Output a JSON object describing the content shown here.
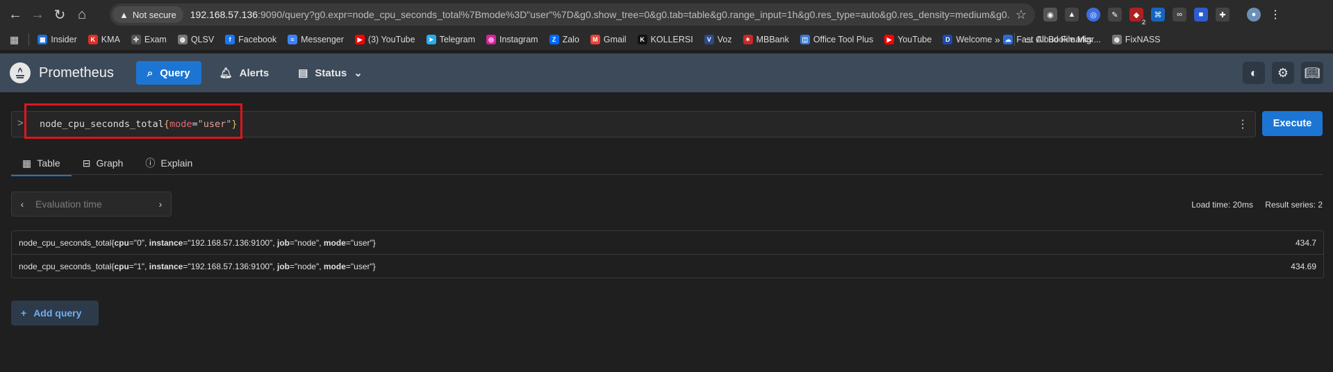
{
  "browser": {
    "security_label": "Not secure",
    "url_host": "192.168.57.136",
    "url_rest": ":9090/query?g0.expr=node_cpu_seconds_total%7Bmode%3D\"user\"%7D&g0.show_tree=0&g0.tab=table&g0.range_input=1h&g0.res_type=auto&g0.res_density=medium&g0....",
    "extension_badge": "2"
  },
  "bookmarks": [
    {
      "label": "Insider",
      "color": "#1e6fd9",
      "glyph": "▦"
    },
    {
      "label": "KMA",
      "color": "#d93025",
      "glyph": "K"
    },
    {
      "label": "Exam",
      "color": "#555555",
      "glyph": "✣"
    },
    {
      "label": "QLSV",
      "color": "#777777",
      "glyph": "◍"
    },
    {
      "label": "Facebook",
      "color": "#1877f2",
      "glyph": "f"
    },
    {
      "label": "Messenger",
      "color": "#3b82f6",
      "glyph": "≈"
    },
    {
      "label": "(3) YouTube",
      "color": "#ff0000",
      "glyph": "▶"
    },
    {
      "label": "Telegram",
      "color": "#2aabee",
      "glyph": "➤"
    },
    {
      "label": "Instagram",
      "color": "#d6249f",
      "glyph": "◎"
    },
    {
      "label": "Zalo",
      "color": "#0068ff",
      "glyph": "Z"
    },
    {
      "label": "Gmail",
      "color": "#ea4335",
      "glyph": "M"
    },
    {
      "label": "KOLLERSI",
      "color": "#111111",
      "glyph": "K"
    },
    {
      "label": "Voz",
      "color": "#2b4a8a",
      "glyph": "V"
    },
    {
      "label": "MBBank",
      "color": "#c62828",
      "glyph": "✶"
    },
    {
      "label": "Office Tool Plus",
      "color": "#3a7bd5",
      "glyph": "◫"
    },
    {
      "label": "YouTube",
      "color": "#ff0000",
      "glyph": "▶"
    },
    {
      "label": "Welcome",
      "color": "#1f4aa8",
      "glyph": "D"
    },
    {
      "label": "Fast Cloud File Migr...",
      "color": "#2c6bd6",
      "glyph": "☁"
    },
    {
      "label": "FixNASS",
      "color": "#777777",
      "glyph": "◍"
    }
  ],
  "all_bookmarks": "All Bookmarks",
  "app": {
    "brand": "Prometheus",
    "nav": {
      "query": "Query",
      "alerts": "Alerts",
      "status": "Status"
    }
  },
  "query": {
    "metric": "node_cpu_seconds_total",
    "open_brace": "{",
    "label": "mode",
    "eq": "=",
    "value": "\"user\"",
    "close_brace": "}"
  },
  "execute_label": "Execute",
  "tabs": {
    "table": "Table",
    "graph": "Graph",
    "explain": "Explain"
  },
  "evaluation_placeholder": "Evaluation time",
  "stats": {
    "load_time": "Load time: 20ms",
    "result_series": "Result series: 2"
  },
  "results": [
    {
      "prefix": "node_cpu_seconds_total{",
      "cpu_key": "cpu",
      "cpu_val": "=\"0\", ",
      "inst_key": "instance",
      "inst_val": "=\"192.168.57.136:9100\", ",
      "job_key": "job",
      "job_val": "=\"node\", ",
      "mode_key": "mode",
      "mode_val": "=\"user\"}",
      "value": "434.7"
    },
    {
      "prefix": "node_cpu_seconds_total{",
      "cpu_key": "cpu",
      "cpu_val": "=\"1\", ",
      "inst_key": "instance",
      "inst_val": "=\"192.168.57.136:9100\", ",
      "job_key": "job",
      "job_val": "=\"node\", ",
      "mode_key": "mode",
      "mode_val": "=\"user\"}",
      "value": "434.69"
    }
  ],
  "add_query_label": "Add query"
}
